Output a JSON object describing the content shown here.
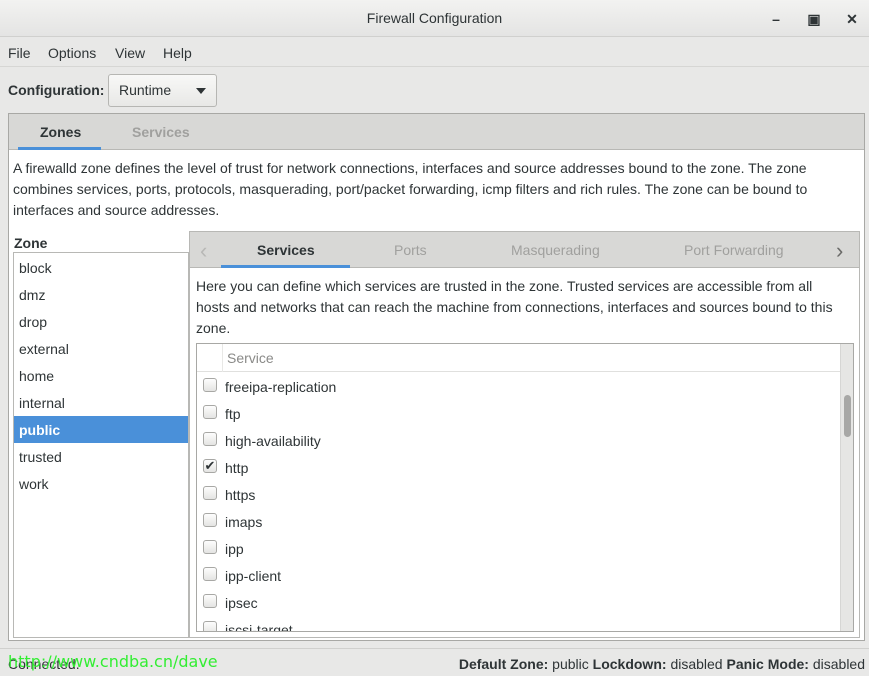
{
  "window": {
    "title": "Firewall Configuration",
    "controls": [
      "minimize",
      "maximize",
      "close"
    ]
  },
  "menu": [
    "File",
    "Options",
    "View",
    "Help"
  ],
  "configuration": {
    "label": "Configuration:",
    "value": "Runtime"
  },
  "main_tabs": [
    {
      "label": "Zones",
      "selected": true
    },
    {
      "label": "Services",
      "selected": false
    }
  ],
  "zone_description": "A firewalld zone defines the level of trust for network connections, interfaces and source addresses bound to the zone. The zone combines services, ports, protocols, masquerading, port/packet forwarding, icmp filters and rich rules. The zone can be bound to interfaces and source addresses.",
  "zone_list": {
    "label": "Zone",
    "items": [
      "block",
      "dmz",
      "drop",
      "external",
      "home",
      "internal",
      "public",
      "trusted",
      "work"
    ],
    "selected": "public"
  },
  "zone_tabs": [
    {
      "label": "Services",
      "selected": true
    },
    {
      "label": "Ports"
    },
    {
      "label": "Masquerading"
    },
    {
      "label": "Port Forwarding"
    }
  ],
  "services_description": "Here you can define which services are trusted in the zone. Trusted services are accessible from all hosts and networks that can reach the machine from connections, interfaces and sources bound to this zone.",
  "services_table": {
    "header": "Service",
    "rows": [
      {
        "name": "freeipa-replication",
        "checked": false
      },
      {
        "name": "ftp",
        "checked": false
      },
      {
        "name": "high-availability",
        "checked": false
      },
      {
        "name": "http",
        "checked": true
      },
      {
        "name": "https",
        "checked": false
      },
      {
        "name": "imaps",
        "checked": false
      },
      {
        "name": "ipp",
        "checked": false
      },
      {
        "name": "ipp-client",
        "checked": false
      },
      {
        "name": "ipsec",
        "checked": false
      },
      {
        "name": "iscsi-target",
        "checked": false
      }
    ]
  },
  "status": {
    "connection": "Connected.",
    "default_zone_label": "Default Zone:",
    "default_zone": "public",
    "lockdown_label": "Lockdown:",
    "lockdown": "disabled",
    "panic_label": "Panic Mode:",
    "panic": "disabled"
  },
  "watermark": "http://www.cndba.cn/dave",
  "colors": {
    "accent": "#4a90d9",
    "watermark": "#33ee33"
  }
}
